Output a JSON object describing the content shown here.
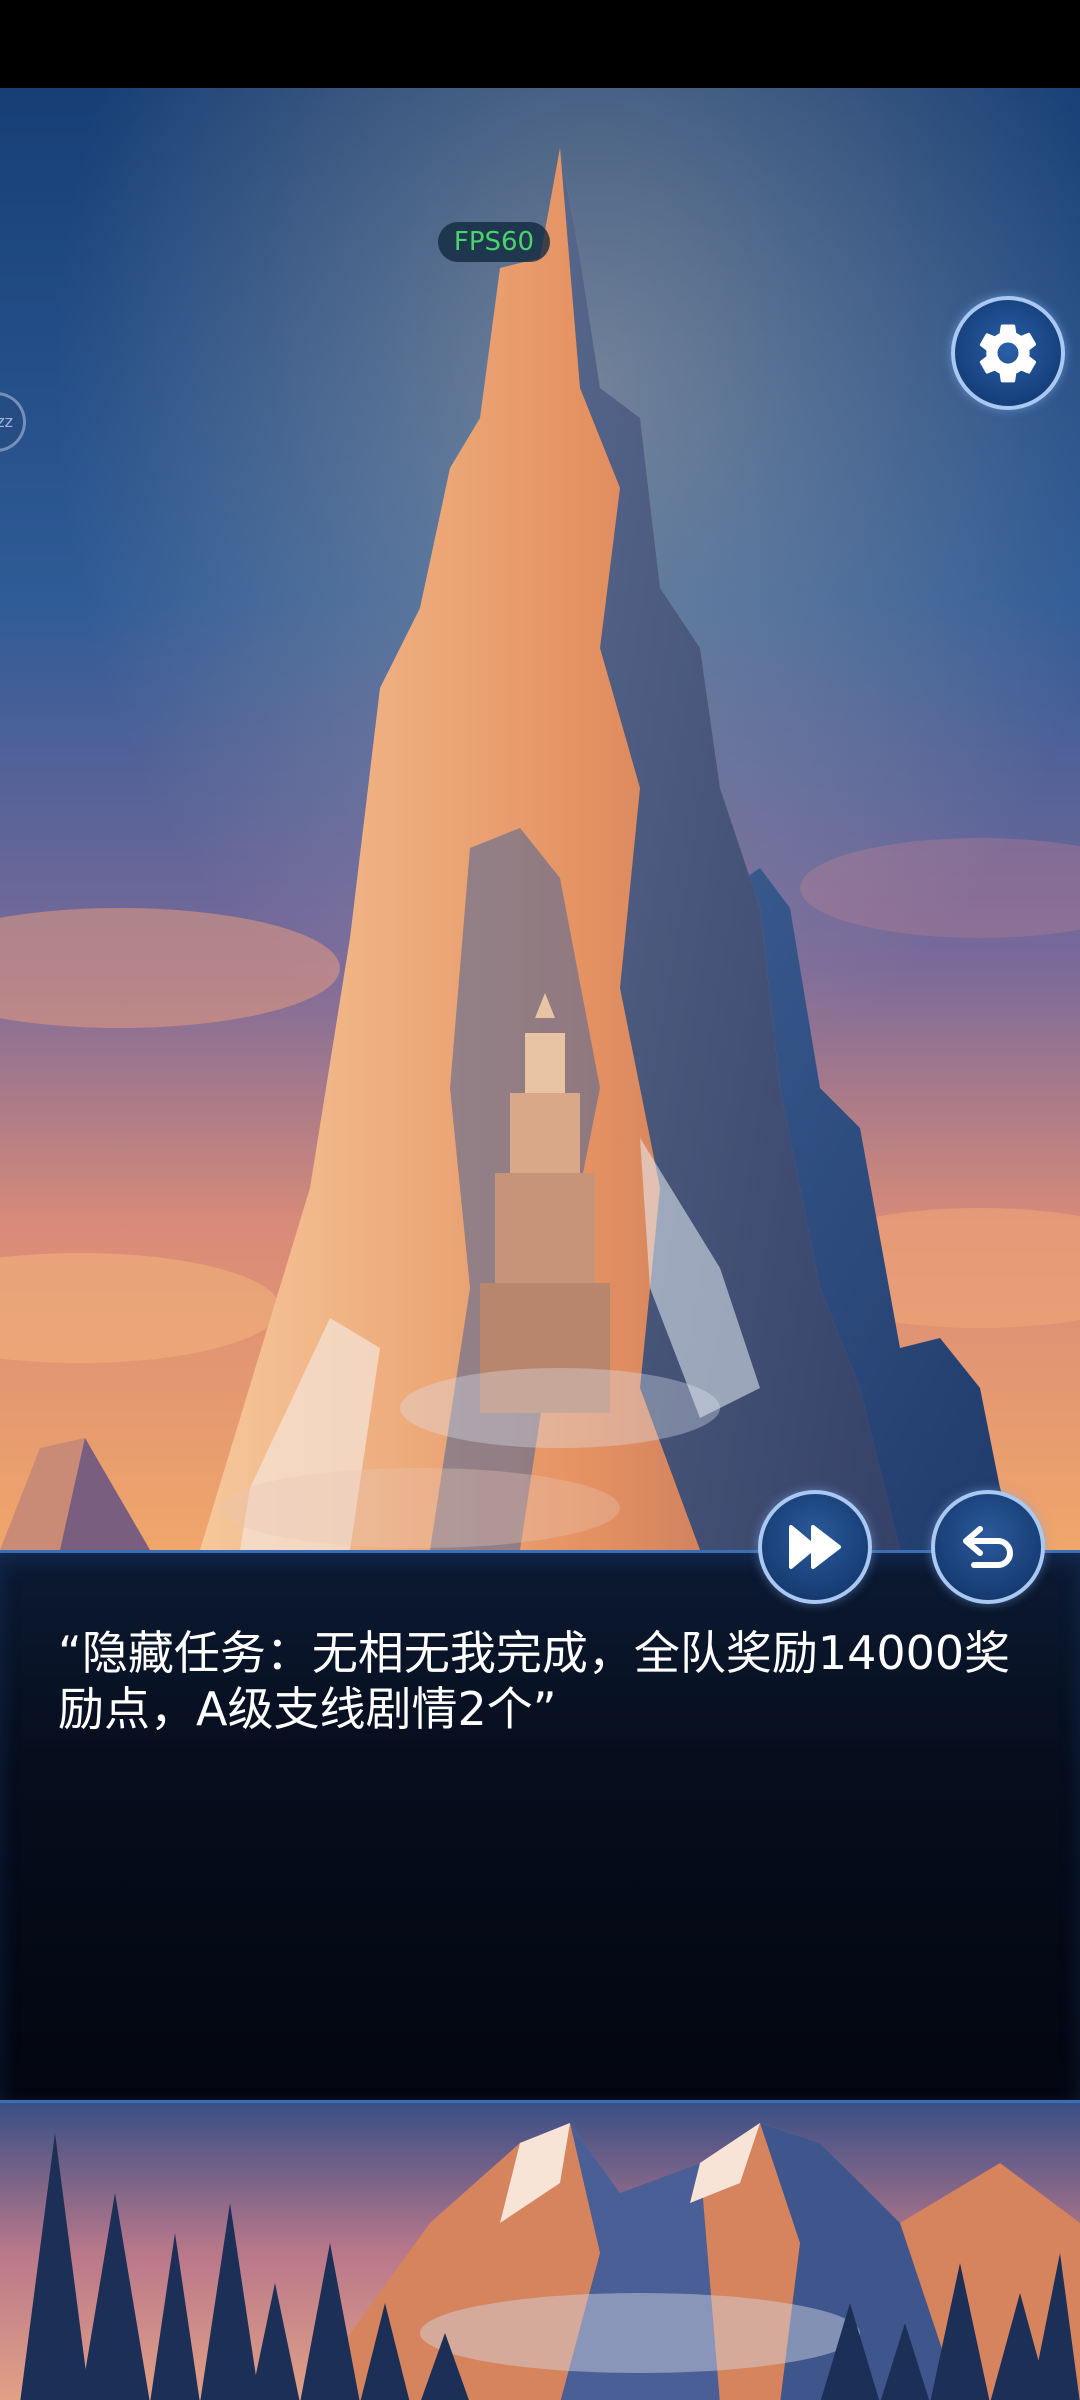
{
  "hud": {
    "fps_label": "FPS60",
    "side_tab_label": "zz"
  },
  "buttons": {
    "settings_icon": "gear-icon",
    "fastforward_icon": "fast-forward-icon",
    "back_icon": "undo-arrow-icon"
  },
  "dialog": {
    "text": "“隐藏任务：无相无我完成，全队奖励14000奖励点，A级支线剧情2个”"
  },
  "colors": {
    "accent": "#a9c8f2",
    "fps_text": "#49d46c",
    "panel": "#060d1c"
  }
}
